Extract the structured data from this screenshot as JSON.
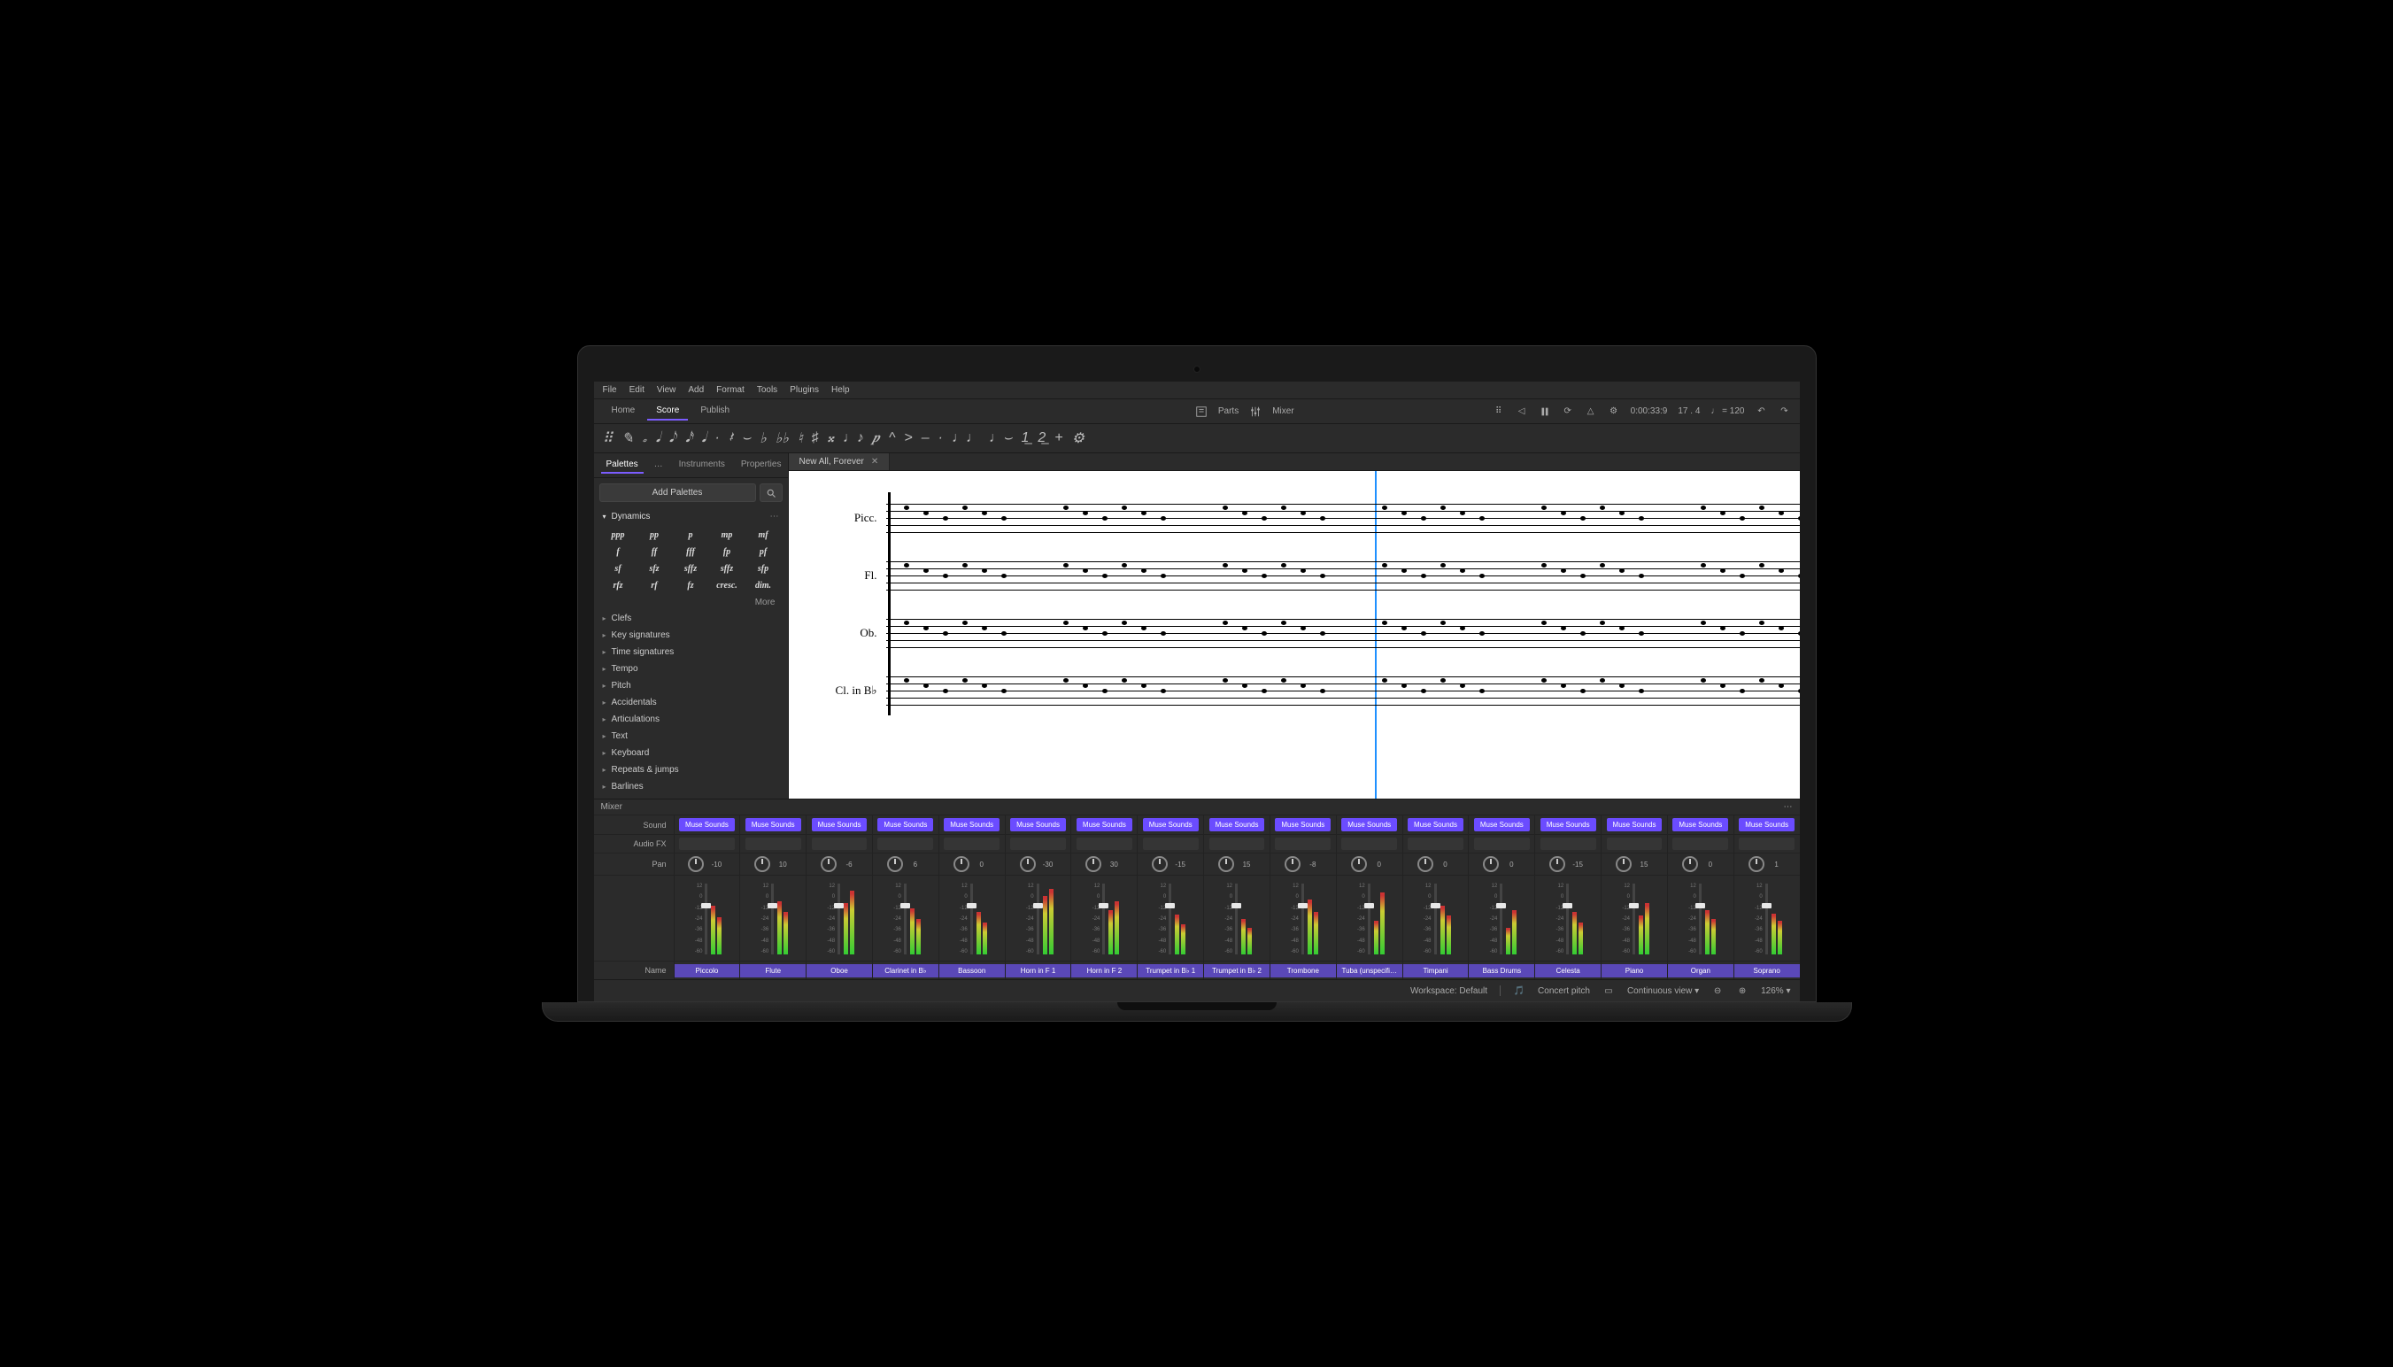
{
  "menu": [
    "File",
    "Edit",
    "View",
    "Add",
    "Format",
    "Tools",
    "Plugins",
    "Help"
  ],
  "nav": {
    "tabs": [
      "Home",
      "Score",
      "Publish"
    ],
    "active": 1,
    "parts": "Parts",
    "mixer": "Mixer",
    "time": "0:00:33:9",
    "bar": "17 . 4",
    "tempo": "♩ = 120"
  },
  "note_toolbar_glyphs": [
    "⠿",
    "✎",
    "𝅗",
    "𝅘𝅥",
    "𝅘𝅥𝅮",
    "𝅘𝅥𝅯",
    "𝅘𝅥",
    "·",
    "𝄽",
    "⌣",
    "♭",
    "♭♭",
    "♮",
    "♯",
    "𝄪",
    "♩♪",
    "𝆏",
    "^",
    ">",
    "–",
    "·",
    "♩♩",
    "♩⌣",
    "1͟",
    "2͟",
    "+",
    "⚙"
  ],
  "side": {
    "tabs": [
      "Palettes",
      "…",
      "Instruments",
      "Properties"
    ],
    "active": 0,
    "add_label": "Add Palettes",
    "dyn_title": "Dynamics",
    "more": "More",
    "dynamics": [
      "ppp",
      "pp",
      "p",
      "mp",
      "mf",
      "f",
      "ff",
      "fff",
      "fp",
      "pf",
      "sf",
      "sfz",
      "sffz",
      "sffz",
      "sfp",
      "rfz",
      "rf",
      "fz",
      "cresc.",
      "dim."
    ],
    "sections": [
      "Clefs",
      "Key signatures",
      "Time signatures",
      "Tempo",
      "Pitch",
      "Accidentals",
      "Articulations",
      "Text",
      "Keyboard",
      "Repeats & jumps",
      "Barlines"
    ]
  },
  "file_tab": "New All, Forever",
  "staves": [
    "Picc.",
    "Fl.",
    "Ob.",
    "Cl. in B♭"
  ],
  "mixer_title": "Mixer",
  "row_labels": {
    "sound": "Sound",
    "fx": "Audio FX",
    "pan": "Pan",
    "name": "Name"
  },
  "sound_chip": "Muse Sounds",
  "fader_scale": [
    "12",
    "0",
    "-12",
    "-24",
    "-36",
    "-48",
    "-60"
  ],
  "channels": [
    {
      "name": "Piccolo",
      "pan": -10,
      "m1": 55,
      "m2": 42
    },
    {
      "name": "Flute",
      "pan": 10,
      "m1": 60,
      "m2": 48
    },
    {
      "name": "Oboe",
      "pan": -6,
      "m1": 58,
      "m2": 72
    },
    {
      "name": "Clarinet in B♭",
      "pan": 6,
      "m1": 52,
      "m2": 40
    },
    {
      "name": "Bassoon",
      "pan": 0,
      "m1": 48,
      "m2": 36
    },
    {
      "name": "Horn in F 1",
      "pan": -30,
      "m1": 66,
      "m2": 74
    },
    {
      "name": "Horn in F 2",
      "pan": 30,
      "m1": 50,
      "m2": 60
    },
    {
      "name": "Trumpet in B♭ 1",
      "pan": -15,
      "m1": 45,
      "m2": 34
    },
    {
      "name": "Trumpet in B♭ 2",
      "pan": 15,
      "m1": 40,
      "m2": 30
    },
    {
      "name": "Trombone",
      "pan": -8,
      "m1": 62,
      "m2": 48
    },
    {
      "name": "Tuba (unspecifi…",
      "pan": 0,
      "m1": 38,
      "m2": 70
    },
    {
      "name": "Timpani",
      "pan": 0,
      "m1": 55,
      "m2": 44
    },
    {
      "name": "Bass Drums",
      "pan": 0,
      "m1": 30,
      "m2": 50
    },
    {
      "name": "Celesta",
      "pan": -15,
      "m1": 48,
      "m2": 36
    },
    {
      "name": "Piano",
      "pan": 15,
      "m1": 44,
      "m2": 58
    },
    {
      "name": "Organ",
      "pan": 0,
      "m1": 50,
      "m2": 40
    },
    {
      "name": "Soprano",
      "pan": 1,
      "m1": 46,
      "m2": 38
    }
  ],
  "status": {
    "workspace": "Workspace: Default",
    "pitch": "Concert pitch",
    "view": "Continuous view ▾",
    "zoom": "126% ▾"
  }
}
